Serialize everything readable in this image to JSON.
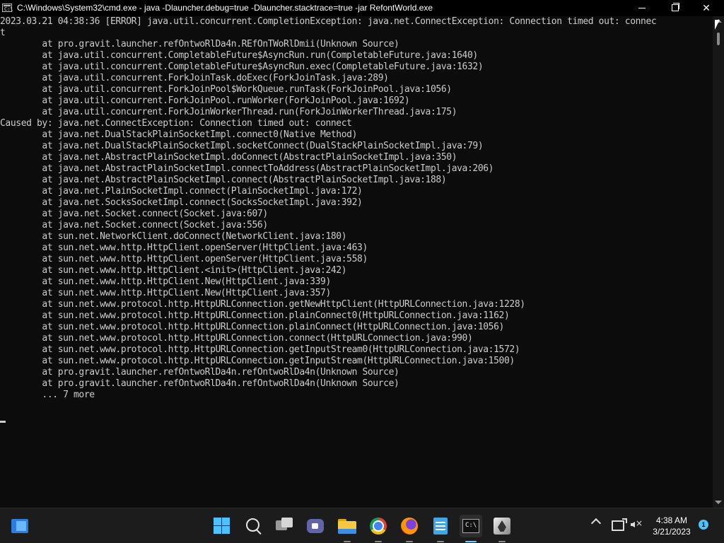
{
  "window": {
    "title": "C:\\Windows\\System32\\cmd.exe - java  -Dlauncher.debug=true -Dlauncher.stacktrace=true -jar RefontWorld.exe",
    "icon": "cmd-icon",
    "icon_glyph": "C:\\",
    "minimize_icon": "minimize-icon",
    "maximize_icon": "restore-icon",
    "close_icon": "close-icon",
    "close_glyph": "✕"
  },
  "console": {
    "lines": [
      "2023.03.21 04:38:36 [ERROR] java.util.concurrent.CompletionException: java.net.ConnectException: Connection timed out: connec",
      "t",
      "        at pro.gravit.launcher.refOntwoRlDa4n.REfOnTWoRlDmii(Unknown Source)",
      "        at java.util.concurrent.CompletableFuture$AsyncRun.run(CompletableFuture.java:1640)",
      "        at java.util.concurrent.CompletableFuture$AsyncRun.exec(CompletableFuture.java:1632)",
      "        at java.util.concurrent.ForkJoinTask.doExec(ForkJoinTask.java:289)",
      "        at java.util.concurrent.ForkJoinPool$WorkQueue.runTask(ForkJoinPool.java:1056)",
      "        at java.util.concurrent.ForkJoinPool.runWorker(ForkJoinPool.java:1692)",
      "        at java.util.concurrent.ForkJoinWorkerThread.run(ForkJoinWorkerThread.java:175)",
      "Caused by: java.net.ConnectException: Connection timed out: connect",
      "        at java.net.DualStackPlainSocketImpl.connect0(Native Method)",
      "        at java.net.DualStackPlainSocketImpl.socketConnect(DualStackPlainSocketImpl.java:79)",
      "        at java.net.AbstractPlainSocketImpl.doConnect(AbstractPlainSocketImpl.java:350)",
      "        at java.net.AbstractPlainSocketImpl.connectToAddress(AbstractPlainSocketImpl.java:206)",
      "        at java.net.AbstractPlainSocketImpl.connect(AbstractPlainSocketImpl.java:188)",
      "        at java.net.PlainSocketImpl.connect(PlainSocketImpl.java:172)",
      "        at java.net.SocksSocketImpl.connect(SocksSocketImpl.java:392)",
      "        at java.net.Socket.connect(Socket.java:607)",
      "        at java.net.Socket.connect(Socket.java:556)",
      "        at sun.net.NetworkClient.doConnect(NetworkClient.java:180)",
      "        at sun.net.www.http.HttpClient.openServer(HttpClient.java:463)",
      "        at sun.net.www.http.HttpClient.openServer(HttpClient.java:558)",
      "        at sun.net.www.http.HttpClient.<init>(HttpClient.java:242)",
      "        at sun.net.www.http.HttpClient.New(HttpClient.java:339)",
      "        at sun.net.www.http.HttpClient.New(HttpClient.java:357)",
      "        at sun.net.www.protocol.http.HttpURLConnection.getNewHttpClient(HttpURLConnection.java:1228)",
      "        at sun.net.www.protocol.http.HttpURLConnection.plainConnect0(HttpURLConnection.java:1162)",
      "        at sun.net.www.protocol.http.HttpURLConnection.plainConnect(HttpURLConnection.java:1056)",
      "        at sun.net.www.protocol.http.HttpURLConnection.connect(HttpURLConnection.java:990)",
      "        at sun.net.www.protocol.http.HttpURLConnection.getInputStream0(HttpURLConnection.java:1572)",
      "        at sun.net.www.protocol.http.HttpURLConnection.getInputStream(HttpURLConnection.java:1500)",
      "        at pro.gravit.launcher.refOntwoRlDa4n.refOntwoRlDa4n(Unknown Source)",
      "        at pro.gravit.launcher.refOntwoRlDa4n.refOntwoRlDa4n(Unknown Source)",
      "        ... 7 more"
    ],
    "text_color": "#cccccc",
    "background": "#0c0c0c"
  },
  "taskbar": {
    "items": [
      {
        "name": "widgets",
        "icon": "widgets-icon"
      },
      {
        "name": "start",
        "icon": "windows-start-icon"
      },
      {
        "name": "search",
        "icon": "search-icon"
      },
      {
        "name": "task-view",
        "icon": "task-view-icon"
      },
      {
        "name": "chat",
        "icon": "chat-icon"
      },
      {
        "name": "file-explorer",
        "icon": "folder-icon"
      },
      {
        "name": "chrome",
        "icon": "chrome-icon"
      },
      {
        "name": "firefox",
        "icon": "firefox-icon"
      },
      {
        "name": "notepad",
        "icon": "notepad-icon"
      },
      {
        "name": "command-prompt",
        "icon": "terminal-icon",
        "active": true
      },
      {
        "name": "game",
        "icon": "game-icon"
      }
    ],
    "tray": {
      "chevron_icon": "chevron-up-icon",
      "network_icon": "network-icon",
      "volume_icon": "volume-muted-icon",
      "time": "4:38 AM",
      "date": "3/21/2023",
      "notification_count": "1"
    },
    "accent": "#60cdff"
  }
}
